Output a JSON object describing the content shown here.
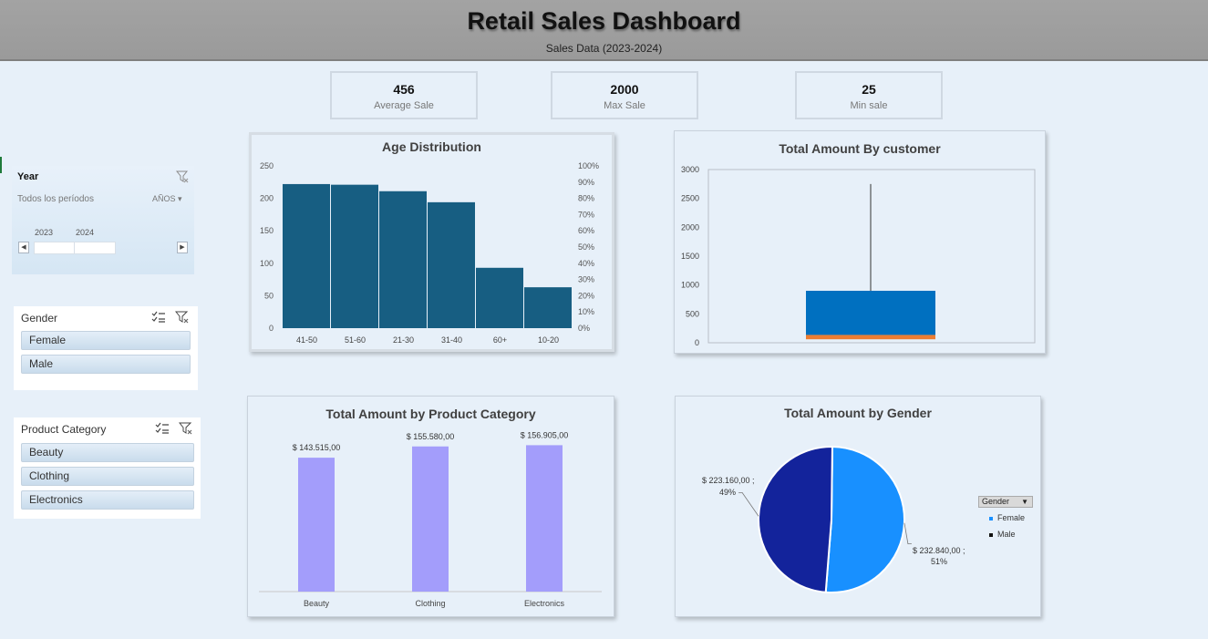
{
  "header": {
    "title": "Retail Sales Dashboard",
    "subtitle": "Sales Data (2023-2024)"
  },
  "kpis": [
    {
      "value": "456",
      "label": "Average Sale"
    },
    {
      "value": "2000",
      "label": "Max Sale"
    },
    {
      "value": "25",
      "label": "Min sale"
    }
  ],
  "year_slicer": {
    "title": "Year",
    "period_label": "Todos los períodos",
    "unit": "AÑOS",
    "years": [
      "2023",
      "2024"
    ]
  },
  "gender_slicer": {
    "title": "Gender",
    "items": [
      "Female",
      "Male"
    ]
  },
  "category_slicer": {
    "title": "Product Category",
    "items": [
      "Beauty",
      "Clothing",
      "Electronics"
    ]
  },
  "pie_legend": {
    "title": "Gender",
    "items": [
      "Female",
      "Male"
    ]
  },
  "colors": {
    "header_bg": "#9e9e9e",
    "background": "#e7f0f9",
    "age_bar": "#175e82",
    "box_blue": "#0070c0",
    "box_orange": "#ed7d31",
    "category_bar": "#a39dfb",
    "female": "#1890ff",
    "male": "#13239b"
  },
  "chart_data": [
    {
      "type": "bar",
      "title": "Age Distribution",
      "categories": [
        "41-50",
        "51-60",
        "21-30",
        "31-40",
        "60+",
        "10-20"
      ],
      "values": [
        222,
        221,
        211,
        194,
        93,
        63
      ],
      "ylim": [
        0,
        250
      ],
      "yticks": [
        "0",
        "50",
        "100",
        "150",
        "200",
        "250"
      ],
      "y2ticks": [
        "0%",
        "10%",
        "20%",
        "30%",
        "40%",
        "50%",
        "60%",
        "70%",
        "80%",
        "90%",
        "100%"
      ]
    },
    {
      "type": "box",
      "title": "Total Amount By customer",
      "ylim": [
        0,
        3000
      ],
      "yticks": [
        "0",
        "500",
        "1000",
        "1500",
        "2000",
        "2500",
        "3000"
      ],
      "min": 25,
      "q1": 60,
      "median": 135,
      "q3": 900,
      "whisker_high": 2750
    },
    {
      "type": "bar",
      "title": "Total Amount by Product Category",
      "categories": [
        "Beauty",
        "Clothing",
        "Electronics"
      ],
      "values": [
        143515,
        155580,
        156905
      ],
      "labels": [
        "$ 143.515,00",
        "$ 155.580,00",
        "$ 156.905,00"
      ]
    },
    {
      "type": "pie",
      "title": "Total Amount by Gender",
      "categories": [
        "Female",
        "Male"
      ],
      "values": [
        232840,
        223160
      ],
      "labels": [
        [
          "$ 232.840,00 ;",
          "51%"
        ],
        [
          "$ 223.160,00 ;",
          "49%"
        ]
      ]
    }
  ]
}
